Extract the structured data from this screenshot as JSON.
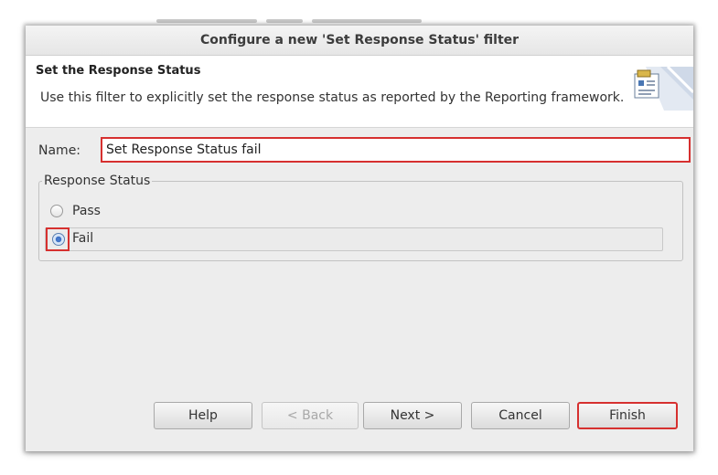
{
  "dialog": {
    "title": "Configure a new 'Set Response Status' filter",
    "banner": {
      "title": "Set the Response Status",
      "description": "Use this filter to explicitly set the response status as reported by the Reporting framework."
    },
    "name": {
      "label": "Name:",
      "value": "Set Response Status fail"
    },
    "response_status": {
      "legend": "Response Status",
      "options": [
        {
          "label": "Pass",
          "selected": false
        },
        {
          "label": "Fail",
          "selected": true
        }
      ]
    },
    "buttons": {
      "help": "Help",
      "back": "< Back",
      "next": "Next >",
      "cancel": "Cancel",
      "finish": "Finish"
    }
  },
  "colors": {
    "highlight": "#d6302f",
    "dialog_bg": "#ededed",
    "banner_bg": "#ffffff",
    "radio_selected": "#3c6fc3"
  }
}
